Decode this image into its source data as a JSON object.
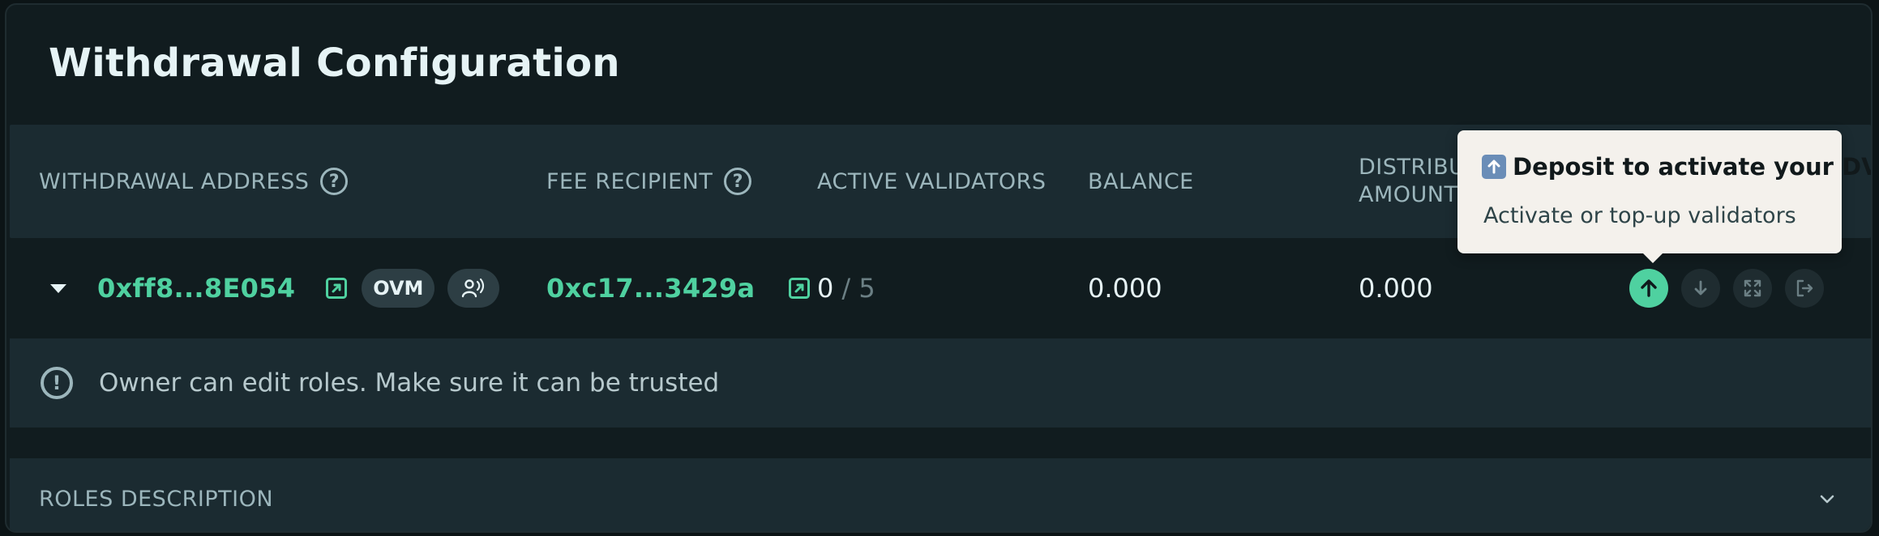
{
  "card": {
    "title": "Withdrawal Configuration"
  },
  "table": {
    "headers": {
      "withdrawal_address": "WITHDRAWAL ADDRESS",
      "fee_recipient": "FEE RECIPIENT",
      "active_validators": "ACTIVE VALIDATORS",
      "balance": "BALANCE",
      "distributable_line1": "DISTRIBUTABLE",
      "distributable_line2": "AMOUNT"
    },
    "row": {
      "withdrawal_address": "0xff8...8E054",
      "badge_ovm": "OVM",
      "fee_recipient": "0xc17...3429a",
      "active_validators": "0",
      "total_validators": "/ 5",
      "balance": "0.000",
      "distributable_amount": "0.000"
    }
  },
  "warning": {
    "text": "Owner can edit roles. Make sure it can be trusted"
  },
  "roles": {
    "label": "ROLES DESCRIPTION"
  },
  "tooltip": {
    "title": "Deposit to activate your DV",
    "subtitle": "Activate or top-up validators"
  },
  "icons": {
    "help": "question-circle-icon",
    "external_link": "external-link-icon",
    "roles": "user-broadcast-icon",
    "deposit": "arrow-up-icon",
    "withdraw": "arrow-down-icon",
    "expand": "expand-icon",
    "exit": "exit-icon",
    "warning": "exclamation-circle-icon",
    "chevron": "chevron-down-icon"
  },
  "colors": {
    "accent": "#4fd1a0",
    "background": "#111c1f",
    "row_alt": "#1b2b31",
    "tooltip_bg": "#f4f1ec"
  }
}
